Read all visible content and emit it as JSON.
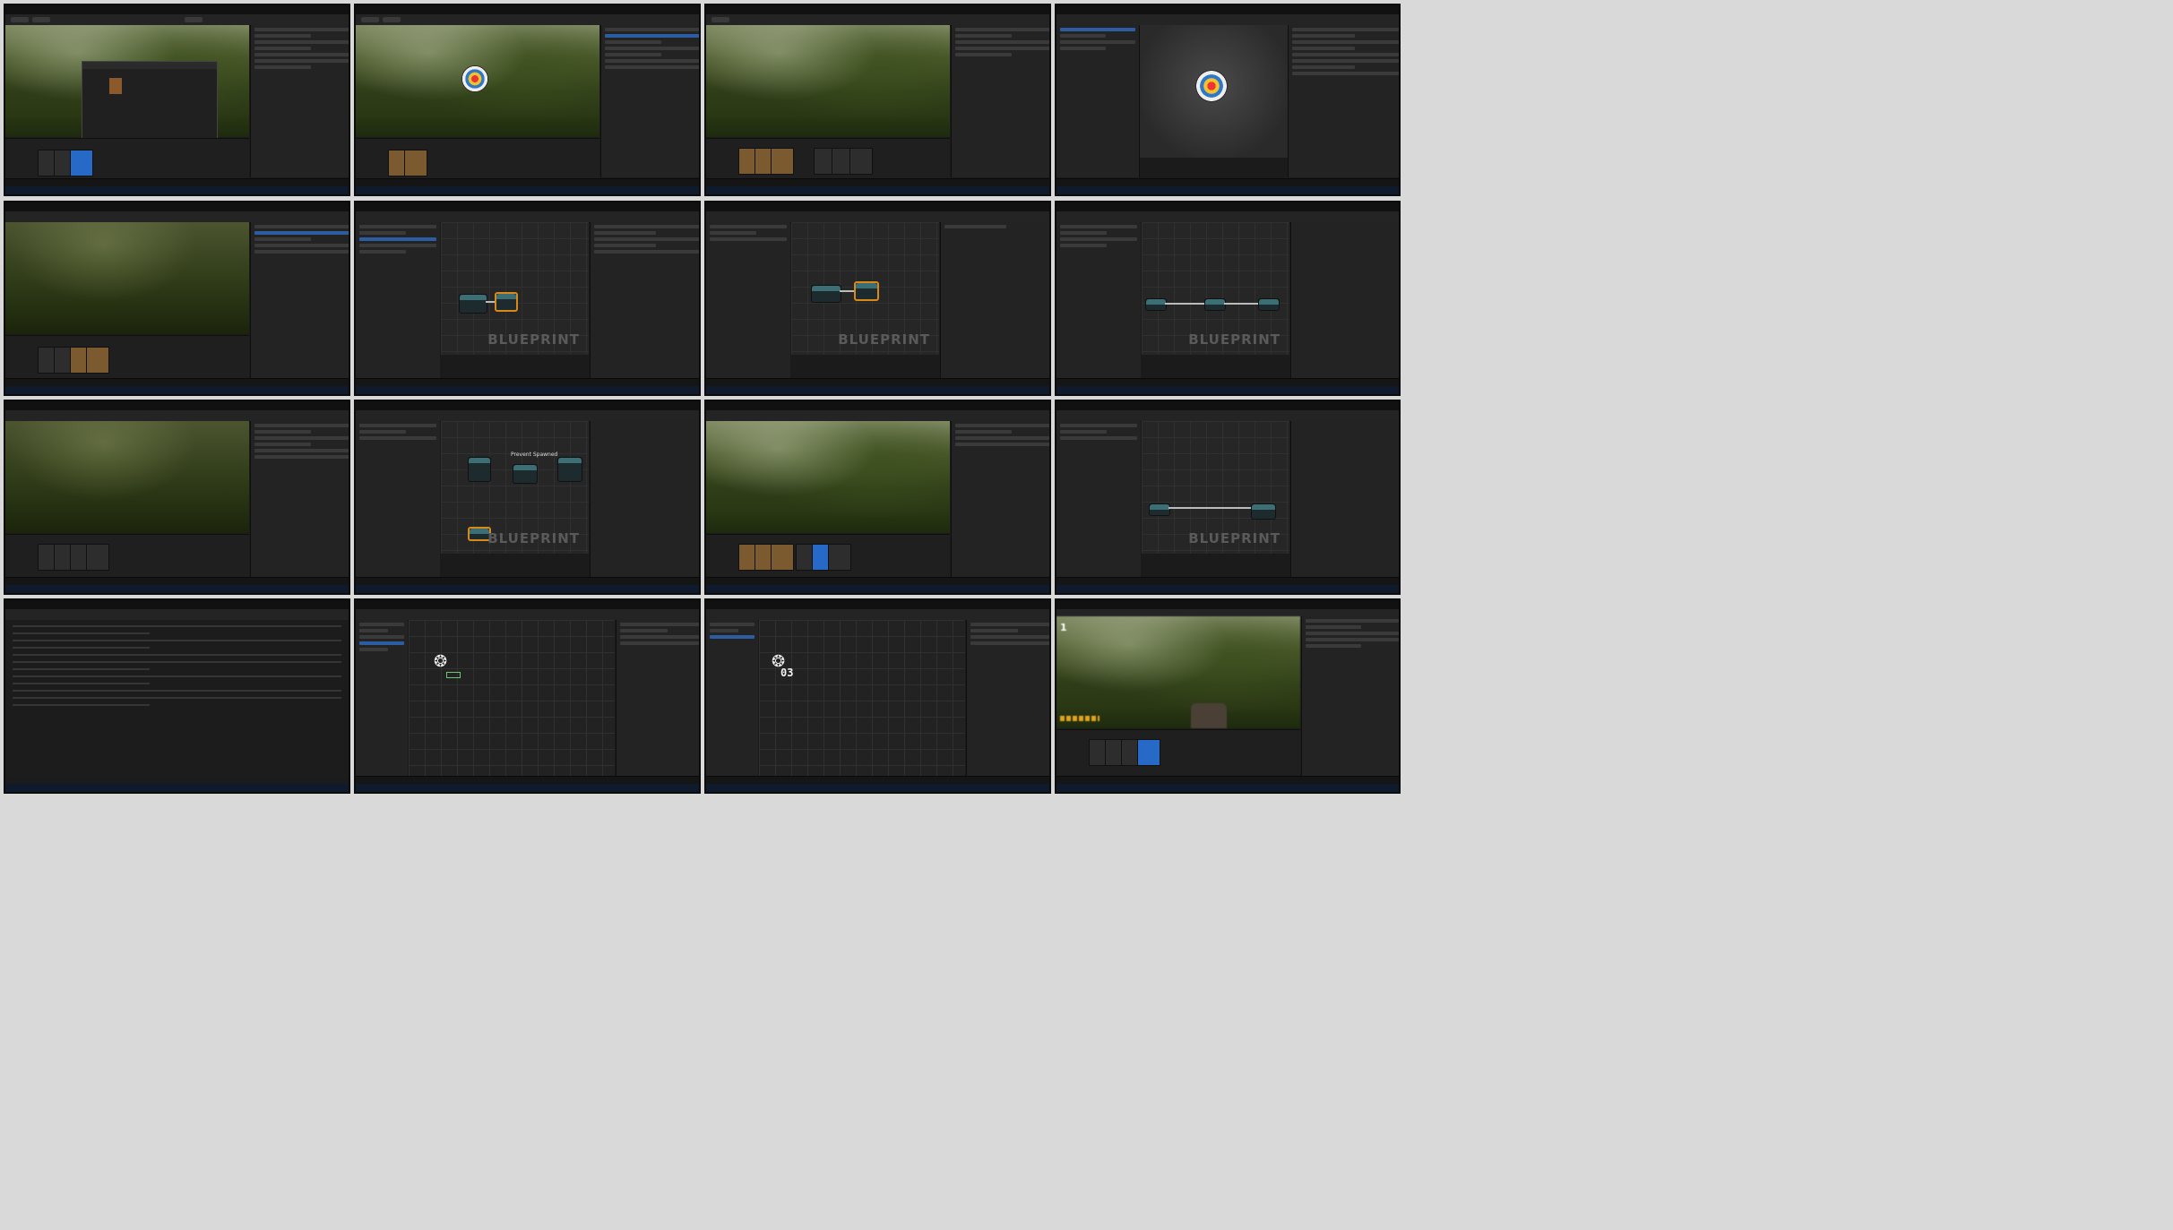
{
  "sheet": {
    "tiles": [
      {
        "id": 1,
        "kind": "editor-viewport",
        "scene": "forest",
        "dialog": "file-picker"
      },
      {
        "id": 2,
        "kind": "editor-viewport",
        "scene": "forest",
        "object": "archery-target"
      },
      {
        "id": 3,
        "kind": "editor-viewport",
        "scene": "forest",
        "content_browser": "assets"
      },
      {
        "id": 4,
        "kind": "asset-editor",
        "object": "archery-target"
      },
      {
        "id": 5,
        "kind": "editor-viewport",
        "scene": "forest-dark"
      },
      {
        "id": 6,
        "kind": "blueprint-graph",
        "watermark": "BLUEPRINT"
      },
      {
        "id": 7,
        "kind": "blueprint-graph",
        "watermark": "BLUEPRINT"
      },
      {
        "id": 8,
        "kind": "blueprint-graph",
        "watermark": "BLUEPRINT"
      },
      {
        "id": 9,
        "kind": "editor-viewport",
        "scene": "forest-dark"
      },
      {
        "id": 10,
        "kind": "blueprint-graph",
        "watermark": "BLUEPRINT",
        "comment": "Prevent Spawned"
      },
      {
        "id": 11,
        "kind": "editor-viewport",
        "scene": "forest",
        "content_browser": "assets"
      },
      {
        "id": 12,
        "kind": "blueprint-graph",
        "watermark": "BLUEPRINT"
      },
      {
        "id": 13,
        "kind": "project-settings"
      },
      {
        "id": 14,
        "kind": "widget-designer",
        "icon": "gear-icon"
      },
      {
        "id": 15,
        "kind": "widget-designer",
        "icon": "gear-icon",
        "label": "03"
      },
      {
        "id": 16,
        "kind": "play-in-editor",
        "scene": "forest",
        "hud_number": "1"
      }
    ]
  },
  "labels": {
    "blueprint": "BLUEPRINT",
    "comment_prevent": "Prevent Spawned",
    "ammo": "03",
    "hud_number": "1"
  },
  "colors": {
    "selection": "#2769c7",
    "node_highlight": "#d88a18",
    "exec_wire": "#bcbcbc",
    "data_wire": "#6dc56d",
    "taskbar": "#0f1a2c"
  }
}
